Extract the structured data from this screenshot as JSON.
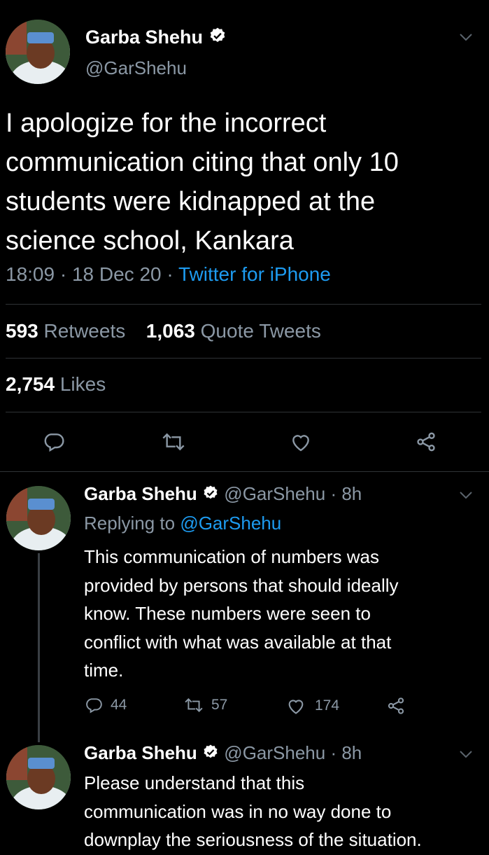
{
  "main_tweet": {
    "author_name": "Garba Shehu",
    "handle": "@GarShehu",
    "text_lines": [
      "I apologize for the incorrect",
      "communication citing that only 10",
      "students were kidnapped at the",
      "science school, Kankara"
    ],
    "time": "18:09",
    "date": "18 Dec 20",
    "source": "Twitter for iPhone",
    "retweets_count": "593",
    "retweets_label": "Retweets",
    "quotes_count": "1,063",
    "quotes_label": "Quote Tweets",
    "likes_count": "2,754",
    "likes_label": "Likes"
  },
  "reply_1": {
    "author_name": "Garba Shehu",
    "handle": "@GarShehu",
    "age": "8h",
    "replying_label": "Replying to",
    "replying_handle": "@GarShehu",
    "text_lines": [
      "This communication of numbers was",
      "provided by persons that should ideally",
      "know. These numbers were seen to",
      "conflict with what was available at that",
      "time."
    ],
    "reply_count": "44",
    "retweet_count": "57",
    "like_count": "174"
  },
  "reply_2": {
    "author_name": "Garba Shehu",
    "handle": "@GarShehu",
    "age": "8h",
    "text_lines": [
      "Please understand that this",
      "communication was in no way done to",
      "downplay the seriousness of the situation."
    ]
  },
  "colors": {
    "background": "#000000",
    "muted": "#8b98a5",
    "link": "#1d9bf0"
  }
}
